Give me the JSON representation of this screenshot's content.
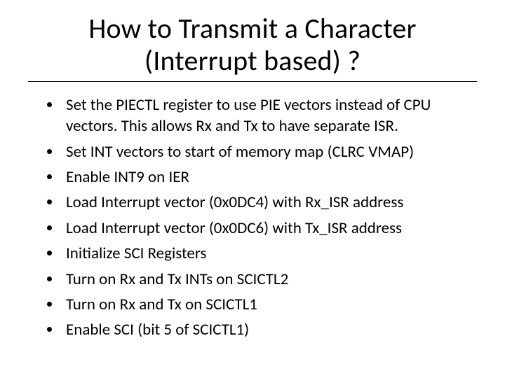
{
  "title_line1": "How to Transmit a Character",
  "title_line2": "(Interrupt based) ?",
  "bullets": [
    "Set the PIECTL register to use PIE vectors instead of CPU vectors. This allows Rx and Tx to have separate ISR.",
    "Set INT vectors to start of memory map (CLRC VMAP)",
    "Enable INT9 on IER",
    "Load Interrupt vector (0x0DC4) with Rx_ISR address",
    "Load Interrupt vector (0x0DC6) with Tx_ISR address",
    "Initialize SCI Registers",
    "Turn on Rx and Tx INTs on SCICTL2",
    "Turn on Rx and Tx on SCICTL1",
    "Enable SCI (bit 5 of SCICTL1)"
  ]
}
